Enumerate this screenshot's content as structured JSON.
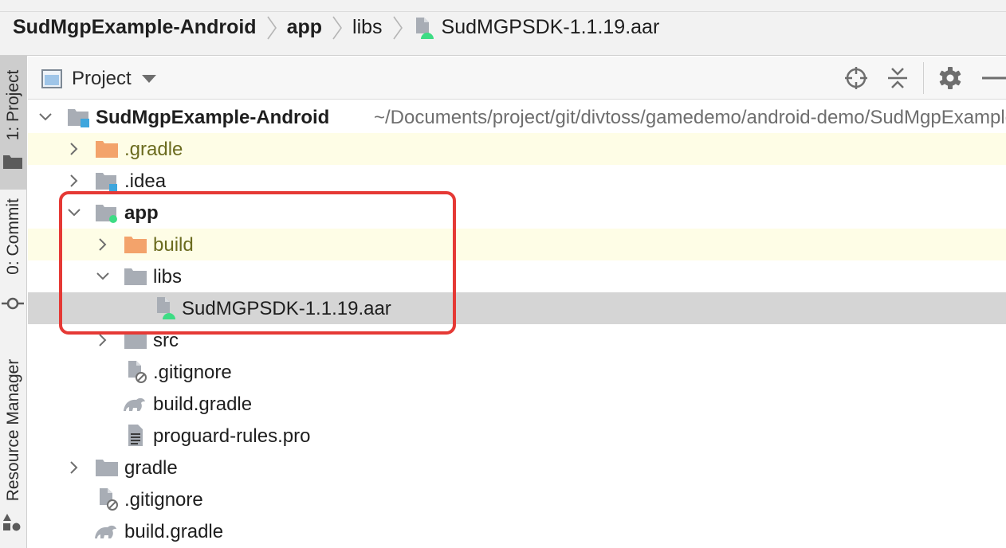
{
  "breadcrumb": {
    "items": [
      {
        "label": "SudMgpExample-Android"
      },
      {
        "label": "app"
      },
      {
        "label": "libs"
      },
      {
        "label": "SudMGPSDK-1.1.19.aar"
      }
    ]
  },
  "tool_strip": {
    "project_tab": "1: Project",
    "commit_tab": "0: Commit",
    "resource_tab": "Resource Manager"
  },
  "panel": {
    "view_selector": "Project"
  },
  "tree": {
    "root": {
      "name": "SudMgpExample-Android",
      "path": "~/Documents/project/git/divtoss/gamedemo/android-demo/SudMgpExample-Android"
    },
    "rows": [
      {
        "name": ".gradle"
      },
      {
        "name": ".idea"
      },
      {
        "name": "app"
      },
      {
        "name": "build"
      },
      {
        "name": "libs"
      },
      {
        "name": "SudMGPSDK-1.1.19.aar"
      },
      {
        "name": "src"
      },
      {
        "name": ".gitignore"
      },
      {
        "name": "build.gradle"
      },
      {
        "name": "proguard-rules.pro"
      },
      {
        "name": "gradle"
      },
      {
        "name": ".gitignore"
      },
      {
        "name": "build.gradle"
      }
    ]
  },
  "colors": {
    "highlight": "#e53935",
    "excluded_folder": "#f3a36b",
    "folder": "#a8adb5",
    "android": "#3ddc84"
  }
}
